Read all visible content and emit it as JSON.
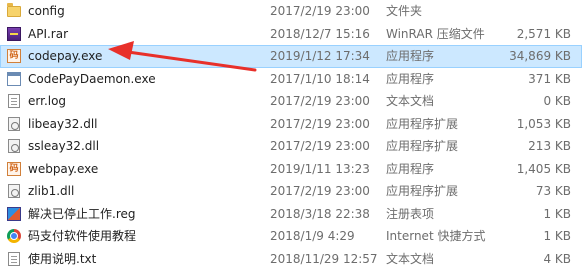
{
  "files": [
    {
      "name": "config",
      "date": "2017/2/19 23:00",
      "type": "文件夹",
      "size": "",
      "icon": "folder-icon"
    },
    {
      "name": "API.rar",
      "date": "2018/12/7 15:16",
      "type": "WinRAR 压缩文件",
      "size": "2,571 KB",
      "icon": "rar-archive-icon"
    },
    {
      "name": "codepay.exe",
      "date": "2019/1/12 17:34",
      "type": "应用程序",
      "size": "34,869 KB",
      "icon": "app-exe-icon",
      "selected": true
    },
    {
      "name": "CodePayDaemon.exe",
      "date": "2017/1/10 18:14",
      "type": "应用程序",
      "size": "371 KB",
      "icon": "window-exe-icon"
    },
    {
      "name": "err.log",
      "date": "2017/2/19 23:00",
      "type": "文本文档",
      "size": "0 KB",
      "icon": "text-document-icon"
    },
    {
      "name": "libeay32.dll",
      "date": "2017/2/19 23:00",
      "type": "应用程序扩展",
      "size": "1,053 KB",
      "icon": "dll-icon"
    },
    {
      "name": "ssleay32.dll",
      "date": "2017/2/19 23:00",
      "type": "应用程序扩展",
      "size": "213 KB",
      "icon": "dll-icon"
    },
    {
      "name": "webpay.exe",
      "date": "2019/1/11 13:23",
      "type": "应用程序",
      "size": "1,405 KB",
      "icon": "app-exe-icon"
    },
    {
      "name": "zlib1.dll",
      "date": "2017/2/19 23:00",
      "type": "应用程序扩展",
      "size": "73 KB",
      "icon": "dll-icon"
    },
    {
      "name": "解决已停止工作.reg",
      "date": "2018/3/18 22:38",
      "type": "注册表项",
      "size": "1 KB",
      "icon": "registry-icon"
    },
    {
      "name": "码支付软件使用教程",
      "date": "2018/1/9 4:29",
      "type": "Internet 快捷方式",
      "size": "1 KB",
      "icon": "chrome-shortcut-icon"
    },
    {
      "name": "使用说明.txt",
      "date": "2018/11/29 12:57",
      "type": "文本文档",
      "size": "4 KB",
      "icon": "text-document-icon"
    }
  ],
  "app_icon_glyph": "码",
  "colors": {
    "selection_bg": "#cce8ff",
    "selection_border": "#99d1ff",
    "arrow": "#e8302a"
  }
}
